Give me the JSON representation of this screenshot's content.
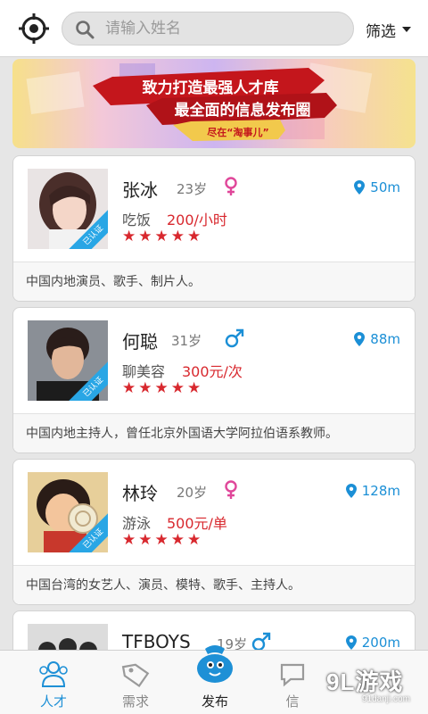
{
  "header": {
    "search_placeholder": "请输入姓名",
    "filter_label": "筛选"
  },
  "banner": {
    "line1": "致力打造最强人才库",
    "line2": "最全面的信息发布圈",
    "line3": "尽在“淘事儿”"
  },
  "colors": {
    "accent": "#1e90d6",
    "price": "#d8282e",
    "female": "#e0479a",
    "male": "#1b8fd6"
  },
  "talents": [
    {
      "name": "张冰",
      "age": "23岁",
      "gender": "female",
      "distance": "50m",
      "skill": "吃饭",
      "price": "200/小时",
      "stars": "★★★★★",
      "badge": "已认证",
      "desc": "中国内地演员、歌手、制片人。"
    },
    {
      "name": "何聪",
      "age": "31岁",
      "gender": "male",
      "distance": "88m",
      "skill": "聊美容",
      "price": "300元/次",
      "stars": "★★★★★",
      "badge": "已认证",
      "desc": "中国内地主持人，曾任北京外国语大学阿拉伯语系教师。"
    },
    {
      "name": "林玲",
      "age": "20岁",
      "gender": "female",
      "distance": "128m",
      "skill": "游泳",
      "price": "500元/单",
      "stars": "★★★★★",
      "badge": "已认证",
      "desc": "中国台湾的女艺人、演员、模特、歌手、主持人。"
    },
    {
      "name": "TFBOYS",
      "age": "19岁",
      "gender": "male",
      "distance": "200m"
    }
  ],
  "tabs": [
    {
      "label": "人才",
      "icon": "people-icon",
      "active": true
    },
    {
      "label": "需求",
      "icon": "tag-icon"
    },
    {
      "label": "发布",
      "icon": "publish-bag-icon"
    },
    {
      "label": "信",
      "icon": "chat-icon"
    }
  ],
  "watermark": {
    "main": "9L游戏",
    "sub": "91danji.com"
  }
}
